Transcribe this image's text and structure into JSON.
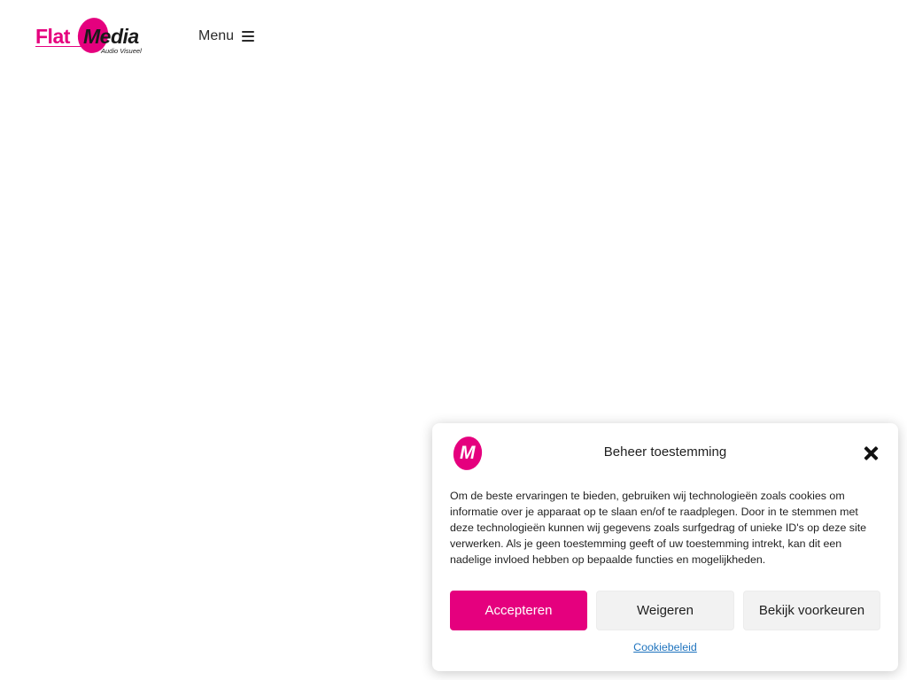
{
  "colors": {
    "brand": "#e5007e",
    "link": "#1e73be",
    "text": "#1f1f1f",
    "button_neutral_bg": "#f2f2f2"
  },
  "header": {
    "logo": {
      "word1": "Flat",
      "word2": "Media",
      "subtitle": "Audio Visueel"
    },
    "menu": {
      "label": "Menu",
      "icon": "hamburger-icon"
    }
  },
  "cookie_banner": {
    "logo_letter": "M",
    "title": "Beheer toestemming",
    "close_icon": "close-icon",
    "message": "Om de beste ervaringen te bieden, gebruiken wij technologieën zoals cookies om informatie over je apparaat op te slaan en/of te raadplegen. Door in te stemmen met deze technologieën kunnen wij gegevens zoals surfgedrag of unieke ID's op deze site verwerken. Als je geen toestemming geeft of uw toestemming intrekt, kan dit een nadelige invloed hebben op bepaalde functies en mogelijkheden.",
    "buttons": {
      "accept": "Accepteren",
      "deny": "Weigeren",
      "preferences": "Bekijk voorkeuren"
    },
    "policy_link": "Cookiebeleid"
  }
}
